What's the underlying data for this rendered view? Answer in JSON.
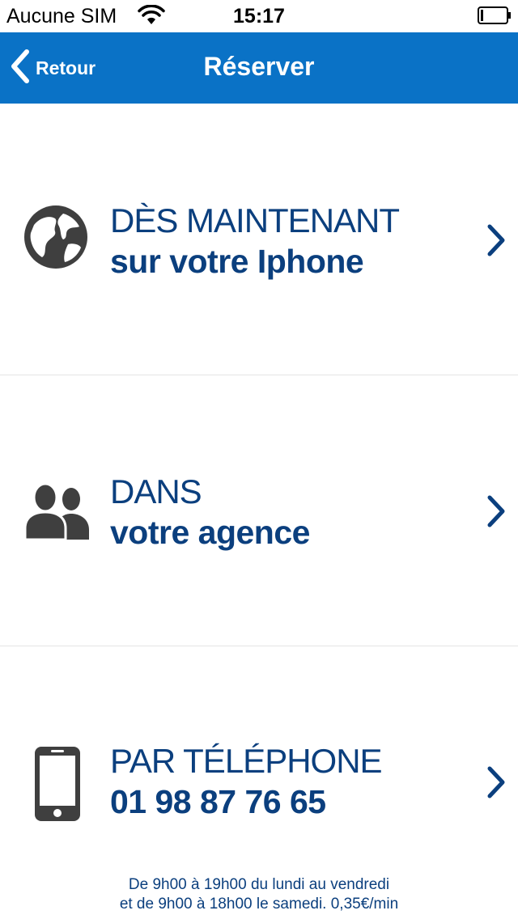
{
  "status_bar": {
    "carrier": "Aucune SIM",
    "time": "15:17",
    "wifi_icon": "wifi-icon",
    "battery_icon": "battery-icon"
  },
  "nav": {
    "back_label": "Retour",
    "title": "Réserver",
    "back_icon": "chevron-left-icon"
  },
  "options": [
    {
      "line1": "DÈS MAINTENANT",
      "line2": "sur votre Iphone",
      "icon": "globe-icon",
      "chevron_icon": "chevron-right-icon"
    },
    {
      "line1": "DANS",
      "line2": "votre agence",
      "icon": "people-icon",
      "chevron_icon": "chevron-right-icon"
    },
    {
      "line1": "PAR TÉLÉPHONE",
      "line2": "01 98 87 76 65",
      "icon": "mobile-phone-icon",
      "chevron_icon": "chevron-right-icon"
    }
  ],
  "hours": {
    "line1": "De 9h00 à 19h00 du lundi au vendredi",
    "line2": "et de 9h00 à 18h00 le samedi. 0,35€/min"
  },
  "colors": {
    "nav_background": "#0a72c6",
    "text_primary": "#0b3f7e",
    "icon_gray": "#3f3f3f",
    "divider": "#e4e4e4"
  }
}
